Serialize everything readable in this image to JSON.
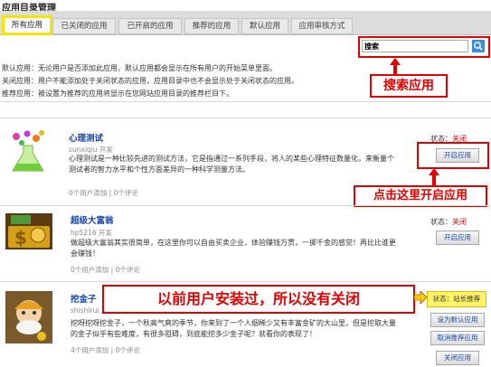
{
  "page_title": "应用目录管理",
  "tabs": [
    "所有应用",
    "已关闭的应用",
    "已开启的应用",
    "推荐的应用",
    "默认应用",
    "应用审核方式"
  ],
  "search": {
    "value": "搜索"
  },
  "callouts": {
    "search": "搜索应用",
    "open": "点击这里开启应用",
    "installed": "以前用户安装过，所以没有关闭"
  },
  "descriptions": [
    "默认应用：无论用户是否添加此应用，默认应用都会显示在所有用户的开始菜单里面。",
    "关闭应用：用户不能添加处于关闭状态的应用，应用目录中也不会显示处于关闭状态的应用。",
    "推荐应用：被设置为推荐的应用将显示在您网站应用目录的推荐栏目下。"
  ],
  "apps": [
    {
      "name": "心理测试",
      "developer": "sunxiqiu 开发",
      "desc1": "心理测试是一种比较先进的测试方法，它是指通过一系列手段，将人的某些心理特征数量化，来衡量个",
      "desc2": "测试者的智力水平和个性方面差异的一种科学测量方法。",
      "stats": "0个用户添加 | 0个评论",
      "status_label": "状态：",
      "status_value": "关闭",
      "buttons": [
        "开启应用"
      ]
    },
    {
      "name": "超级大富翁",
      "developer": "hp5216 开发",
      "desc1": "做超级大富翁其实很简单，在这里你可以自由买卖企业，体验赚钱万贯，一掷千金的感觉！再比比谁更",
      "desc2": "会赚钱！",
      "stats": "0个用户添加 | 0个评论",
      "status_label": "状态：",
      "status_value": "关闭",
      "buttons": [
        "开启应用"
      ]
    },
    {
      "name": "挖金子",
      "developer": "shishirui 开发",
      "desc1": "挖呀挖呀挖金子，一个秋高气爽的季节，你来到了一个人烟稀少又有丰富金矿的大山里，但是挖取大量",
      "desc2": "的金子似乎有些难度，有很多阻碍，到底能挖多少金子呢？就看你的表现了！",
      "stats": "4个用户添加 | 0个评论",
      "status_label": "状态：",
      "status_value": "站长推荐",
      "buttons": [
        "设为默认应用",
        "取消推荐应用",
        "关闭应用"
      ]
    }
  ]
}
